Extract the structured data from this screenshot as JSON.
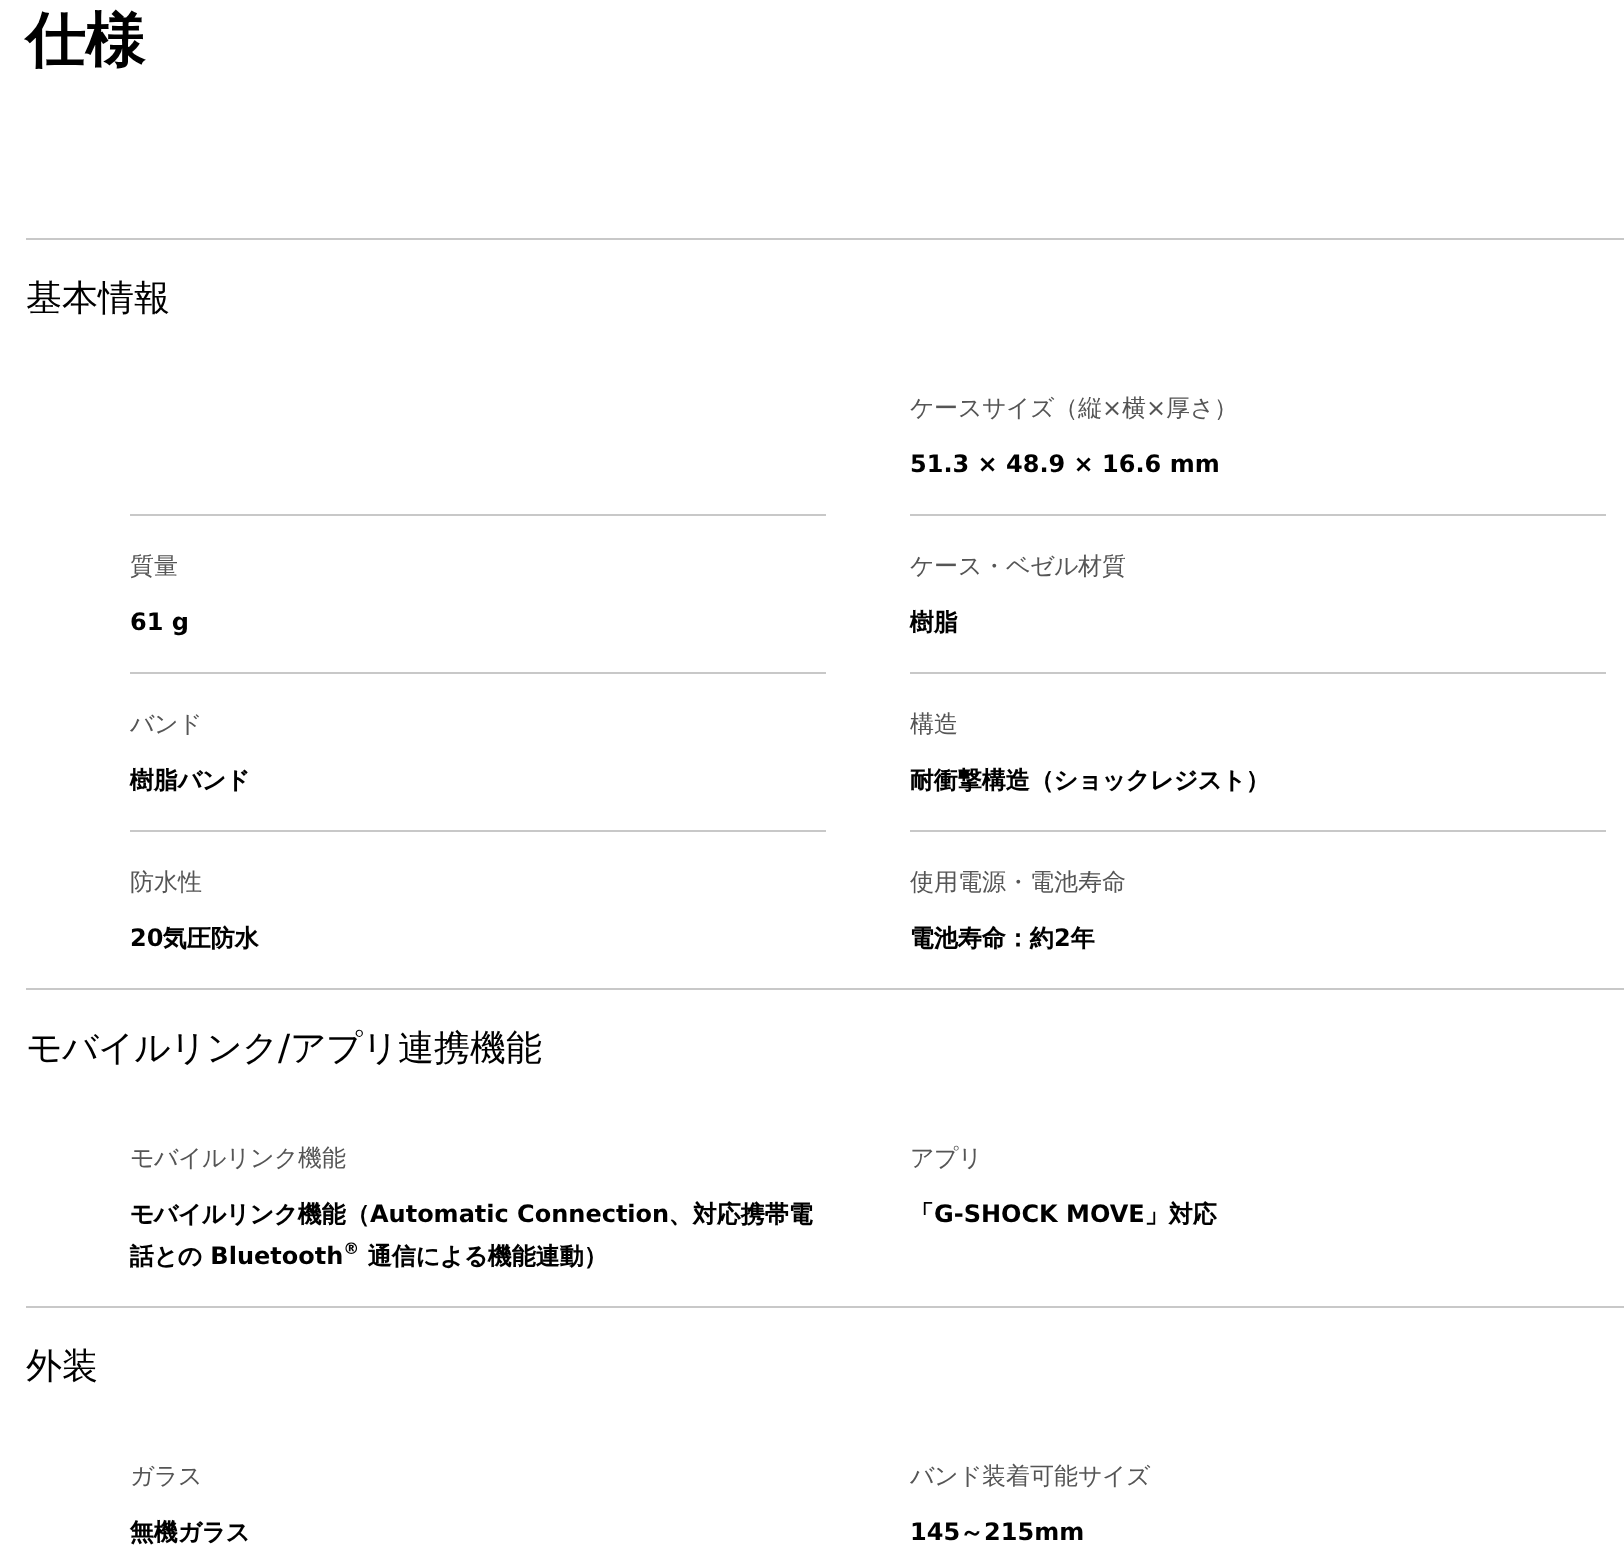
{
  "title": "仕様",
  "sections": [
    {
      "heading": "基本情報",
      "items": [
        {
          "kind": "blank"
        },
        {
          "kind": "spec",
          "label": "ケースサイズ（縦×横×厚さ）",
          "value": "51.3 × 48.9 × 16.6 mm"
        },
        {
          "kind": "spec",
          "label": "質量",
          "value": "61 g"
        },
        {
          "kind": "spec",
          "label": "ケース・ベゼル材質",
          "value": "樹脂"
        },
        {
          "kind": "spec",
          "label": "バンド",
          "value": "樹脂バンド"
        },
        {
          "kind": "spec",
          "label": "構造",
          "value": "耐衝撃構造（ショックレジスト）"
        },
        {
          "kind": "spec",
          "label": "防水性",
          "value": "20気圧防水"
        },
        {
          "kind": "spec",
          "label": "使用電源・電池寿命",
          "value": "電池寿命：約2年"
        }
      ]
    },
    {
      "heading": "モバイルリンク/アプリ連携機能",
      "items": [
        {
          "kind": "spec",
          "label": "モバイルリンク機能",
          "value": "モバイルリンク機能（Automatic Connection、対応携帯電話との Bluetooth$^{®}$ 通信による機能連動）"
        },
        {
          "kind": "spec",
          "label": "アプリ",
          "value": "「G-SHOCK MOVE」対応"
        }
      ]
    },
    {
      "heading": "外装",
      "items": [
        {
          "kind": "spec",
          "label": "ガラス",
          "value": "無機ガラス"
        },
        {
          "kind": "spec",
          "label": "バンド装着可能サイズ",
          "value": "145～215mm"
        }
      ]
    }
  ]
}
